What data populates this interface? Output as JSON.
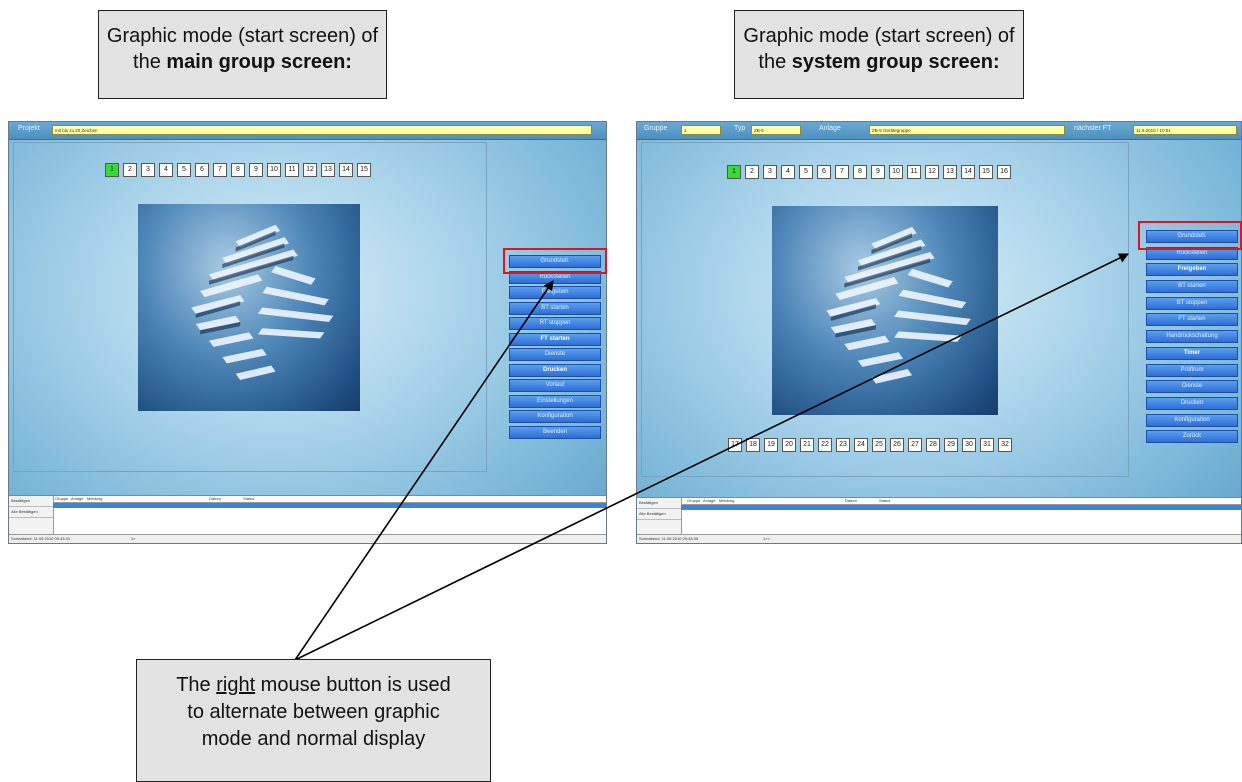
{
  "callouts": {
    "main": {
      "line1": "Graphic mode (start screen) of",
      "line2_prefix": "the ",
      "line2_bold": "main group screen:"
    },
    "system": {
      "line1": "Graphic mode (start screen) of",
      "line2_prefix": "the ",
      "line2_bold": "system group screen:"
    },
    "bottom": {
      "line1_prefix": "The ",
      "line1_underline": "right",
      "line1_suffix": " mouse button is used",
      "line2": "to alternate between graphic",
      "line3": "mode and normal display"
    }
  },
  "main_screen": {
    "topbar": {
      "label": "Projekt",
      "field": "mit bis zu 20 Zeichen"
    },
    "numbers": [
      "1",
      "2",
      "3",
      "4",
      "5",
      "6",
      "7",
      "8",
      "9",
      "10",
      "11",
      "12",
      "13",
      "14",
      "15"
    ],
    "buttons": [
      "Grundstell.",
      "Rückstellen",
      "Freigeben",
      "BT starten",
      "RT stoppen",
      "FT starten",
      "Dienste",
      "Drucken",
      "Vorlauf",
      "Einstellungen",
      "Konfiguration",
      "Beenden"
    ],
    "table": {
      "left_labels": [
        "Bestätigen",
        "Alle Bestätigen"
      ],
      "columns": [
        "Gruppe",
        "Anlage",
        "Meldung",
        "Datum",
        "Status"
      ]
    },
    "status": {
      "date": "Sonnabend, 11.09.2010 09:43:31",
      "page": "1>"
    }
  },
  "system_screen": {
    "topbar": {
      "gruppe_label": "Gruppe",
      "gruppe_value": "1",
      "typ_label": "Typ",
      "typ_value": "ZB-5",
      "anlage_label": "Anlage",
      "anlage_value": "ZB-5 Gerätegruppe",
      "next_label": "nächster FT",
      "next_value": "11.9.2010 / 10:01"
    },
    "numbers_top": [
      "1",
      "2",
      "3",
      "4",
      "5",
      "6",
      "7",
      "8",
      "9",
      "10",
      "11",
      "12",
      "13",
      "14",
      "15",
      "16"
    ],
    "numbers_bottom": [
      "17",
      "18",
      "19",
      "20",
      "21",
      "22",
      "23",
      "24",
      "25",
      "26",
      "27",
      "28",
      "29",
      "30",
      "31",
      "32"
    ],
    "buttons": [
      "Grundstell.",
      "Rückstellen",
      "Freigeben",
      "BT starten",
      "BT stoppen",
      "FT starten",
      "Handrückschaltung",
      "Timer",
      "Prüftrum",
      "Dienste",
      "Drucken",
      "Konfiguration",
      "Zurück"
    ],
    "table": {
      "left_labels": [
        "Bestätigen",
        "Alle Bestätigen"
      ],
      "columns": [
        "Gruppe",
        "Anlage",
        "Meldung",
        "Datum",
        "Status"
      ]
    },
    "status": {
      "date": "Sonnabend, 11.09.2010 09:43:35",
      "page": "1>>"
    }
  },
  "colors": {
    "highlight": "#e0141e",
    "active_number": "#33dd33",
    "button": "#3a7ee0",
    "field": "#ffffa8"
  }
}
